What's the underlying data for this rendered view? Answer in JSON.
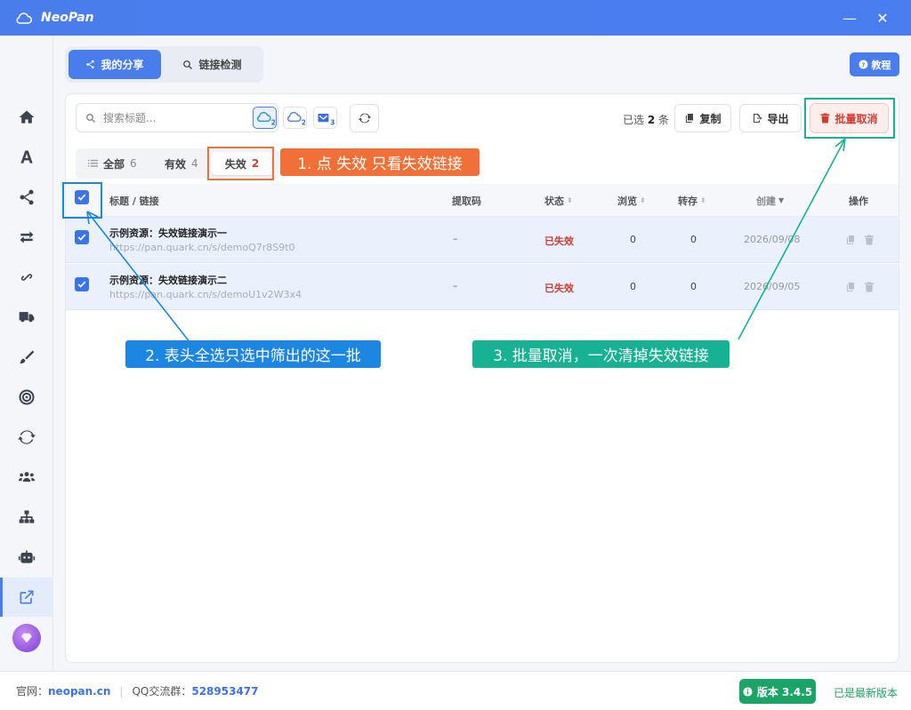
{
  "app": {
    "title": "NeoPan"
  },
  "window": {
    "minimize": "—",
    "close": "✕"
  },
  "sidebar": {
    "items": [
      "home-icon",
      "font-icon",
      "share-icon",
      "transfer-icon",
      "link-icon",
      "truck-icon",
      "brush-icon",
      "target-icon",
      "sync-icon",
      "users-icon",
      "sitemap-icon",
      "robot-icon",
      "external-link-icon"
    ],
    "active": "external-link-icon"
  },
  "topnav": {
    "my_share": "我的分享",
    "link_check": "链接检测"
  },
  "tutorial": "教程",
  "toolbar": {
    "search_placeholder": "搜索标题...",
    "cloud_badges": [
      "2",
      "2",
      "3"
    ],
    "selected_prefix": "已选",
    "selected_count": "2",
    "selected_suffix": "条",
    "copy": "复制",
    "export": "导出",
    "batch_cancel": "批量取消"
  },
  "filter": {
    "all_label": "全部",
    "all_count": "6",
    "valid_label": "有效",
    "valid_count": "4",
    "invalid_label": "失效",
    "invalid_count": "2"
  },
  "table": {
    "headers": {
      "title": "标题 / 链接",
      "code": "提取码",
      "status": "状态",
      "views": "浏览",
      "saves": "转存",
      "created": "创建",
      "actions": "操作"
    },
    "rows": [
      {
        "title": "示例资源：失效链接演示一",
        "url": "https://pan.quark.cn/s/demoQ7r8S9t0",
        "code": "–",
        "status": "已失效",
        "views": "0",
        "saves": "0",
        "created": "2026/09/08"
      },
      {
        "title": "示例资源：失效链接演示二",
        "url": "https://pan.quark.cn/s/demoU1v2W3x4",
        "code": "–",
        "status": "已失效",
        "views": "0",
        "saves": "0",
        "created": "2026/09/05"
      }
    ]
  },
  "annotations": {
    "step1": "1. 点 失效 只看失效链接",
    "step2": "2. 表头全选只选中筛出的这一批",
    "step3": "3. 批量取消，一次清掉失效链接"
  },
  "colors": {
    "primary": "#4a7dec",
    "orange": "#f07038",
    "blue_callout": "#1c86e3",
    "green_callout": "#16b293",
    "danger": "#d33b2f",
    "success": "#1aa566"
  },
  "footer": {
    "site_label": "官网：",
    "site": "neopan.cn",
    "qq_label": "QQ交流群：",
    "qq": "528953477",
    "version": "版本 3.4.5",
    "latest": "已是最新版本"
  }
}
